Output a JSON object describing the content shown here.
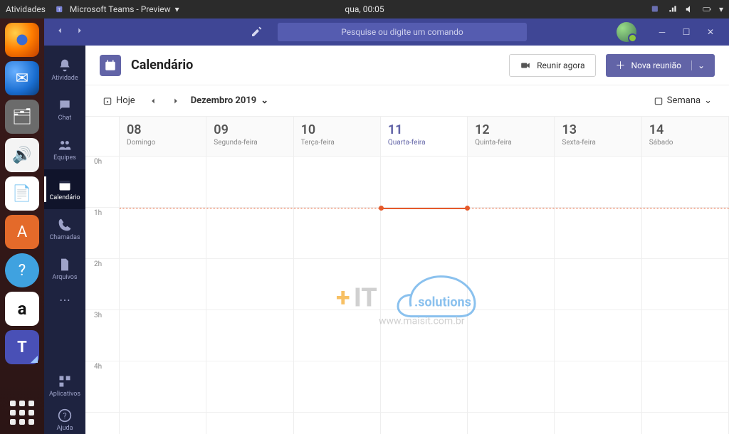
{
  "ubuntu": {
    "activities": "Atividades",
    "app_label": "Microsoft Teams - Preview",
    "clock": "qua, 00:05"
  },
  "dock": {
    "tooltip": "Mostrar aplicativos"
  },
  "titlebar": {
    "search_placeholder": "Pesquise ou digite um comando"
  },
  "rail": {
    "activity": "Atividade",
    "chat": "Chat",
    "teams": "Equipes",
    "calendar": "Calendário",
    "calls": "Chamadas",
    "files": "Arquivos",
    "apps": "Aplicativos",
    "help": "Ajuda"
  },
  "calendar": {
    "title": "Calendário",
    "meet_now": "Reunir agora",
    "new_meeting": "Nova reunião",
    "today": "Hoje",
    "month_label": "Dezembro 2019",
    "view_label": "Semana",
    "days": [
      {
        "num": "08",
        "name": "Domingo"
      },
      {
        "num": "09",
        "name": "Segunda-feira"
      },
      {
        "num": "10",
        "name": "Terça-feira"
      },
      {
        "num": "11",
        "name": "Quarta-feira",
        "today": true
      },
      {
        "num": "12",
        "name": "Quinta-feira"
      },
      {
        "num": "13",
        "name": "Sexta-feira"
      },
      {
        "num": "14",
        "name": "Sábado"
      }
    ],
    "hours": [
      "0h",
      "1h",
      "2h",
      "3h",
      "4h"
    ],
    "current_day_index": 3
  },
  "watermark": {
    "line1_plus": "+",
    "line1_it": "IT",
    "line1_sol": ".solutions",
    "line2": "www.maisit.com.br"
  }
}
